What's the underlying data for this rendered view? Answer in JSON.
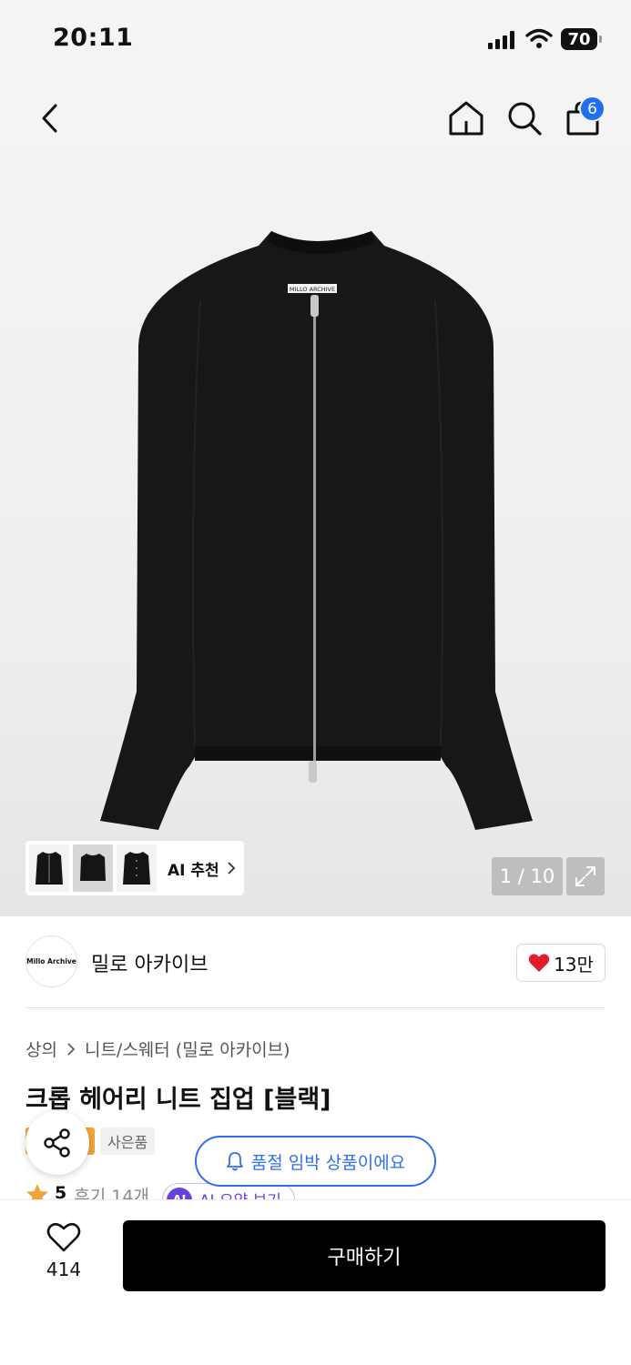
{
  "status_bar": {
    "time": "20:11",
    "battery": "70"
  },
  "nav": {
    "cart_count": "6"
  },
  "gallery": {
    "image_label_text": "MILLO ARCHIVE",
    "ai_recommend_label": "AI 추천",
    "counter": "1 / 10"
  },
  "brand": {
    "logo_text": "Millo Archive",
    "name": "밀로 아카이브",
    "likes": "13만"
  },
  "breadcrumb": {
    "level1": "상의",
    "level2": "니트/스웨터 (밀로 아카이브)"
  },
  "product": {
    "title": "크롭 헤어리 니트 집업 [블랙]",
    "gift_tag": "사은품",
    "rating": "5",
    "reviews": "후기 14개",
    "ai_badge": "AI",
    "ai_summary": "AI 요약 보기"
  },
  "toast": {
    "text": "품절 임박 상품이에요"
  },
  "bottom": {
    "wish_count": "414",
    "buy_label": "구매하기"
  },
  "colors": {
    "accent_blue": "#2f6fec",
    "badge_blue": "#1f6ff0",
    "heart_red": "#e11d2a",
    "ai_purple": "#6a3fe0",
    "star_orange": "#f2a33a",
    "tag_orange": "#f2a33a",
    "button_black": "#000000"
  }
}
